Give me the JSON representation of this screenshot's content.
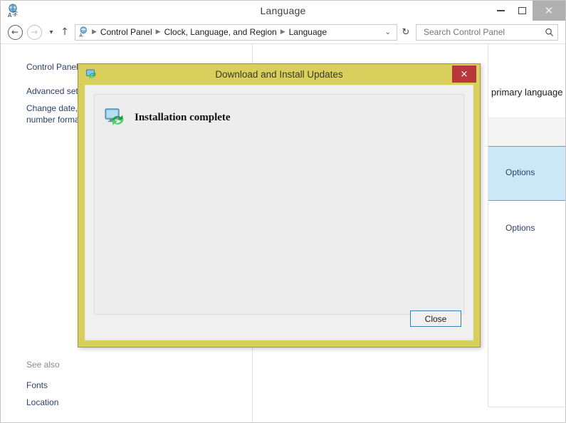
{
  "window": {
    "title": "Language",
    "icon": "language-icon",
    "controls": {
      "minimize_label": "Minimize",
      "maximize_label": "Maximize",
      "close_label": "Close"
    }
  },
  "addressbar": {
    "back_label": "Back",
    "forward_label": "Forward",
    "recent_label": "Recent pages",
    "up_label": "Up",
    "refresh_label": "Refresh",
    "breadcrumb": [
      "Control Panel",
      "Clock, Language, and Region",
      "Language"
    ],
    "separator": "▶",
    "dropdown_glyph": "⌄",
    "refresh_glyph": "↻"
  },
  "search": {
    "placeholder": "Search Control Panel",
    "value": "",
    "icon": "search-icon"
  },
  "sidebar": {
    "items": [
      {
        "label": "Control Panel Home"
      },
      {
        "label": "Advanced settings"
      },
      {
        "label": "Change date, time, or number formats"
      }
    ],
    "see_also": {
      "label": "See also",
      "items": [
        {
          "label": "Fonts"
        },
        {
          "label": "Location"
        }
      ]
    }
  },
  "main": {
    "description_tail": "primary language",
    "language_rows": [
      {
        "action_label": "Options",
        "selected": true
      },
      {
        "action_label": "Options",
        "selected": false
      }
    ]
  },
  "dialog": {
    "title": "Download and Install Updates",
    "icon": "update-icon",
    "close_glyph": "×",
    "status_icon": "monitor-update-icon",
    "status_text": "Installation complete",
    "buttons": {
      "close_label": "Close"
    }
  },
  "colors": {
    "dialog_border": "#d9cf5d",
    "dialog_close_red": "#b9373a",
    "selection_blue": "#cbe8f6",
    "selection_border": "#5aa9c9",
    "link_blue": "#2c3e66",
    "focus_border": "#3c7fb1"
  }
}
